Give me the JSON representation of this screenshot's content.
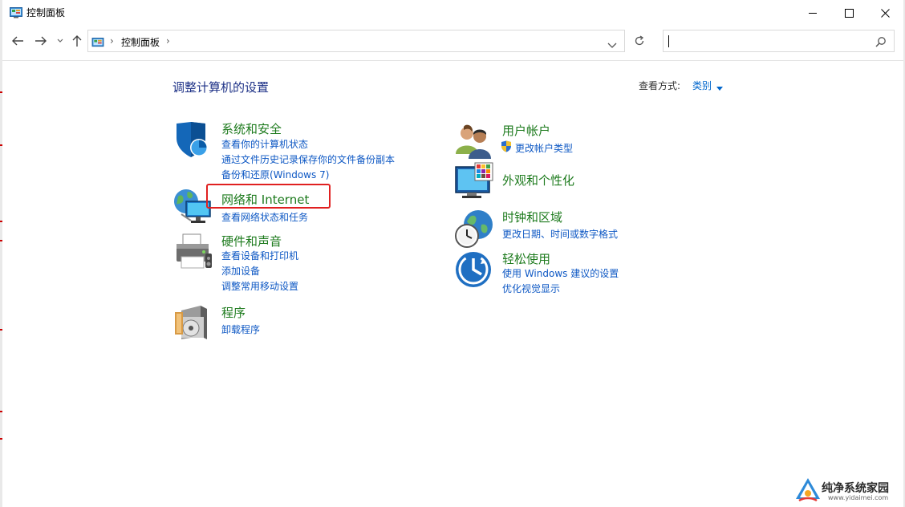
{
  "window": {
    "title": "控制面板"
  },
  "nav": {
    "breadcrumb": "控制面板",
    "crumb_separator": "›",
    "search_placeholder": ""
  },
  "main": {
    "heading": "调整计算机的设置",
    "view_by_label": "查看方式:",
    "view_by_value": "类别"
  },
  "categories": [
    {
      "id": "system-security",
      "title": "系统和安全",
      "icon": "shield-icon",
      "links": [
        "查看你的计算机状态",
        "通过文件历史记录保存你的文件备份副本",
        "备份和还原(Windows 7)"
      ]
    },
    {
      "id": "network-internet",
      "title": "网络和 Internet",
      "icon": "network-globe-icon",
      "links": [
        "查看网络状态和任务"
      ]
    },
    {
      "id": "hardware-sound",
      "title": "硬件和声音",
      "icon": "printer-icon",
      "links": [
        "查看设备和打印机",
        "添加设备",
        "调整常用移动设置"
      ]
    },
    {
      "id": "programs",
      "title": "程序",
      "icon": "programs-disc-icon",
      "links": [
        "卸载程序"
      ]
    },
    {
      "id": "user-accounts",
      "title": "用户帐户",
      "icon": "users-icon",
      "links": [
        "更改帐户类型"
      ]
    },
    {
      "id": "appearance",
      "title": "外观和个性化",
      "icon": "monitor-palette-icon",
      "links": []
    },
    {
      "id": "clock-region",
      "title": "时钟和区域",
      "icon": "clock-globe-icon",
      "links": [
        "更改日期、时间或数字格式"
      ]
    },
    {
      "id": "ease-of-access",
      "title": "轻松使用",
      "icon": "ease-of-access-icon",
      "links": [
        "使用 Windows 建议的设置",
        "优化视觉显示"
      ]
    }
  ],
  "watermark": {
    "text": "纯净系统家园",
    "url": "www.yidaimei.com"
  },
  "colors": {
    "category_title": "#1e7b1e",
    "link": "#0e58c4",
    "heading": "#1e3287",
    "highlight": "#e02020"
  }
}
